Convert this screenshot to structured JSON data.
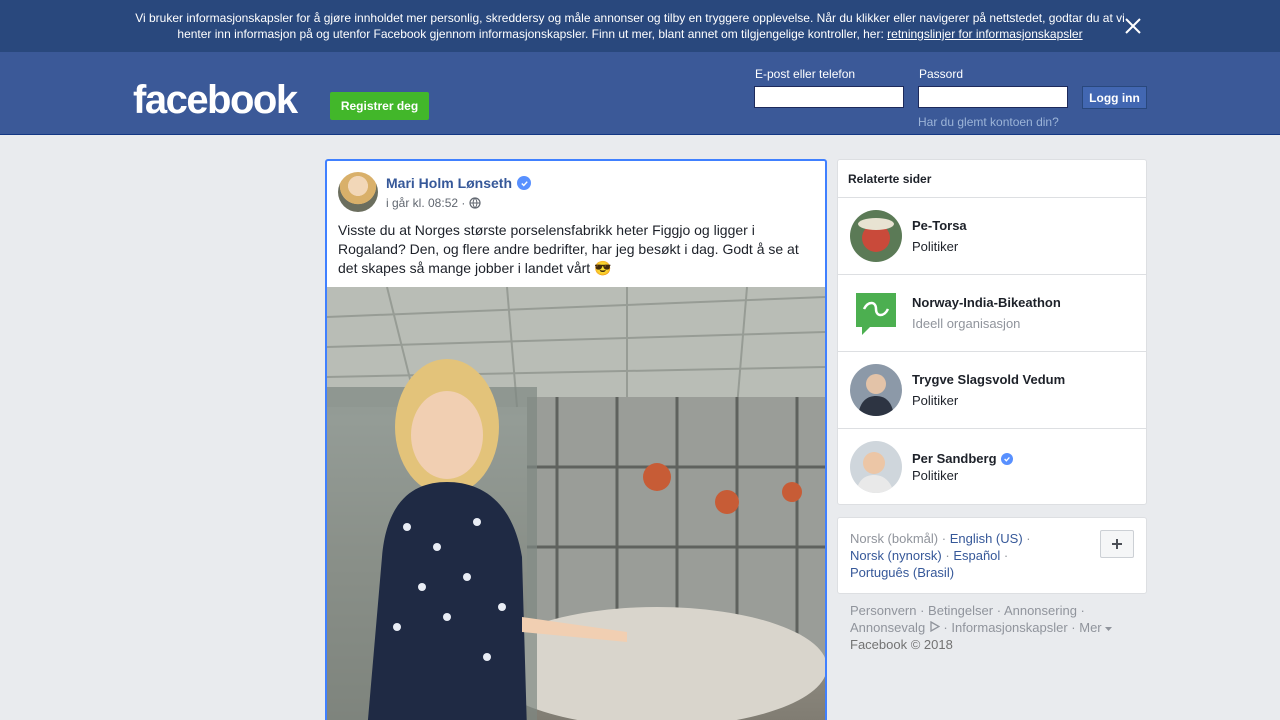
{
  "cookie": {
    "text": "Vi bruker informasjonskapsler for å gjøre innholdet mer personlig, skreddersy og måle annonser og tilby en tryggere opplevelse. Når du klikker eller navigerer på nettstedet, godtar du at vi henter inn informasjon på og utenfor Facebook gjennom informasjonskapsler. Finn ut mer, blant annet om tilgjengelige kontroller, her: ",
    "link": "retningslinjer for informasjonskapsler"
  },
  "header": {
    "logo": "facebook",
    "register": "Registrer deg",
    "email_label": "E-post eller telefon",
    "password_label": "Passord",
    "login": "Logg inn",
    "forgot": "Har du glemt kontoen din?"
  },
  "post": {
    "author": "Mari Holm Lønseth",
    "time": "i går kl. 08:52 ·",
    "text": "Visste du at Norges største porselensfabrikk heter Figgjo og ligger i Rogaland? Den, og flere andre bedrifter, har jeg besøkt i dag. Godt å se at det skapes så mange jobber i landet vårt 😎"
  },
  "related": {
    "title": "Relaterte sider",
    "items": [
      {
        "name": "Pe-Torsa",
        "category": "Politiker",
        "verified": false
      },
      {
        "name": "Norway-India-Bikeathon",
        "category": "Ideell organisasjon",
        "verified": false
      },
      {
        "name": "Trygve Slagsvold Vedum",
        "category": "Politiker",
        "verified": false
      },
      {
        "name": "Per Sandberg",
        "category": "Politiker",
        "verified": true
      }
    ]
  },
  "languages": {
    "current": "Norsk (bokmål)",
    "en": "English (US)",
    "nn": "Norsk (nynorsk)",
    "es": "Español",
    "pt": "Português (Brasil)"
  },
  "footer": {
    "privacy": "Personvern",
    "terms": "Betingelser",
    "ads": "Annonsering",
    "adchoices": "Annonsevalg",
    "cookies": "Informasjonskapsler",
    "more": "Mer",
    "copyright": "Facebook © 2018"
  },
  "colors": {
    "brand": "#3b5998",
    "banner": "#29487d",
    "register": "#42b72a",
    "link": "#365899"
  }
}
